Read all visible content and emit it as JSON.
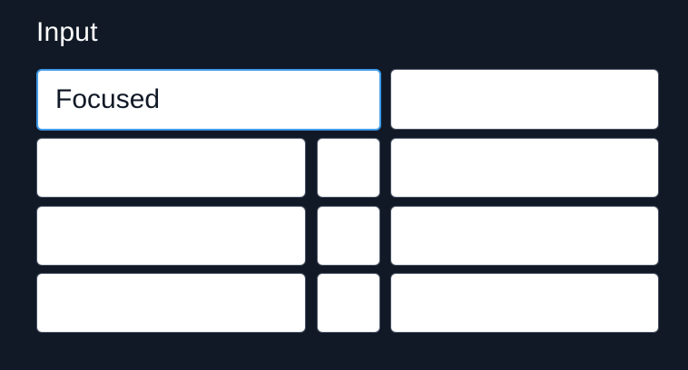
{
  "section": {
    "title": "Input"
  },
  "inputs": {
    "focused_value": "Focused",
    "r1_right": "",
    "r2_left": "",
    "r2_mid": "",
    "r2_right": "",
    "r3_left": "",
    "r3_mid": "",
    "r3_right": "",
    "r4_left": "",
    "r4_mid": "",
    "r4_right": ""
  },
  "colors": {
    "page_background": "#111926",
    "field_background": "#ffffff",
    "focus_ring": "#3f9ae9"
  }
}
